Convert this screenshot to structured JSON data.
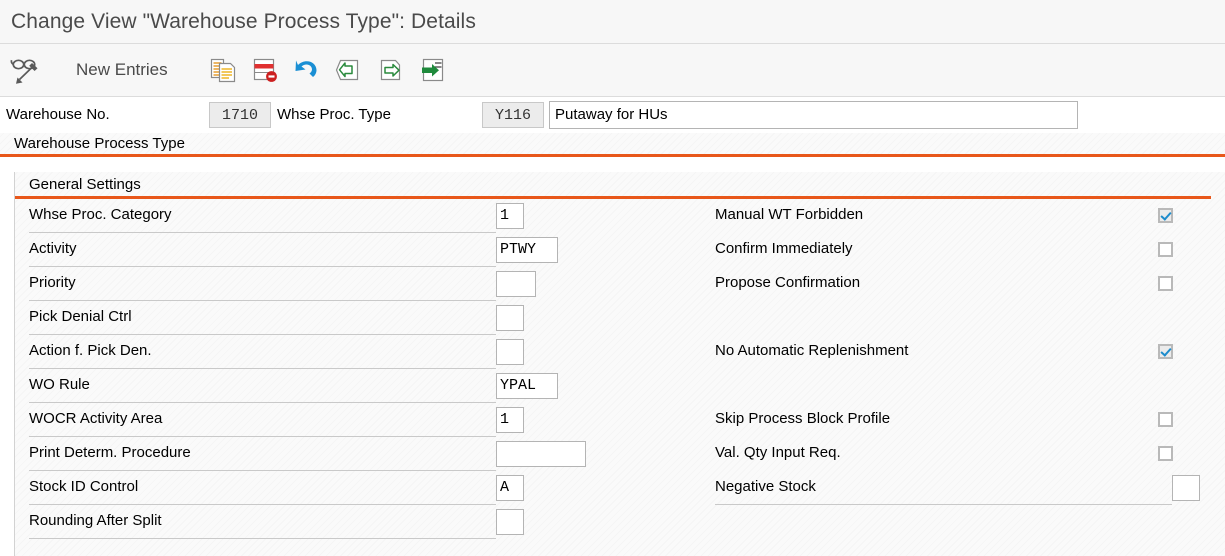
{
  "window": {
    "title": "Change View \"Warehouse Process Type\": Details"
  },
  "toolbar": {
    "display_change_icon": "glasses-pencil-icon",
    "new_entries_label": "New Entries",
    "buttons": [
      {
        "name": "copy-as-icon",
        "label": "Copy As..."
      },
      {
        "name": "delete-icon",
        "label": "Delete"
      },
      {
        "name": "undo-icon",
        "label": "Undo"
      },
      {
        "name": "previous-entry-icon",
        "label": "Previous Entry"
      },
      {
        "name": "next-entry-icon",
        "label": "Next Entry"
      },
      {
        "name": "details-icon",
        "label": "Details"
      }
    ]
  },
  "key_fields": {
    "warehouse_no_label": "Warehouse No.",
    "warehouse_no_value": "1710",
    "whse_proc_type_label": "Whse Proc. Type",
    "whse_proc_type_value": "Y116",
    "description_value": "Putaway for HUs"
  },
  "tabs": {
    "outer_label": "Warehouse Process Type",
    "inner_label": "General Settings",
    "accent_color": "#e8571a"
  },
  "form": {
    "left_fields": [
      {
        "label": "Whse Proc. Category",
        "value": "1",
        "width": 28
      },
      {
        "label": "Activity",
        "value": "PTWY",
        "width": 62
      },
      {
        "label": "Priority",
        "value": "",
        "width": 40
      },
      {
        "label": "Pick Denial Ctrl",
        "value": "",
        "width": 28
      },
      {
        "label": "Action f. Pick Den.",
        "value": "",
        "width": 28
      },
      {
        "label": "WO Rule",
        "value": "YPAL",
        "width": 62
      },
      {
        "label": "WOCR Activity Area",
        "value": "1",
        "width": 28
      },
      {
        "label": "Print Determ. Procedure",
        "value": "",
        "width": 90
      },
      {
        "label": "Stock ID Control",
        "value": "A",
        "width": 28
      },
      {
        "label": "Rounding After Split",
        "value": "",
        "width": 28
      }
    ],
    "right_fields": [
      {
        "label": "Manual WT Forbidden",
        "type": "checkbox",
        "checked": true,
        "row": 0
      },
      {
        "label": "Confirm Immediately",
        "type": "checkbox",
        "checked": false,
        "row": 1
      },
      {
        "label": "Propose Confirmation",
        "type": "checkbox",
        "checked": false,
        "row": 2
      },
      {
        "label": "No Automatic Replenishment",
        "type": "checkbox",
        "checked": true,
        "row": 4
      },
      {
        "label": "Skip Process Block Profile",
        "type": "checkbox",
        "checked": false,
        "row": 6
      },
      {
        "label": "Val. Qty Input Req.",
        "type": "checkbox",
        "checked": false,
        "row": 7
      },
      {
        "label": "Negative Stock",
        "type": "input",
        "value": "",
        "row": 8
      }
    ]
  }
}
